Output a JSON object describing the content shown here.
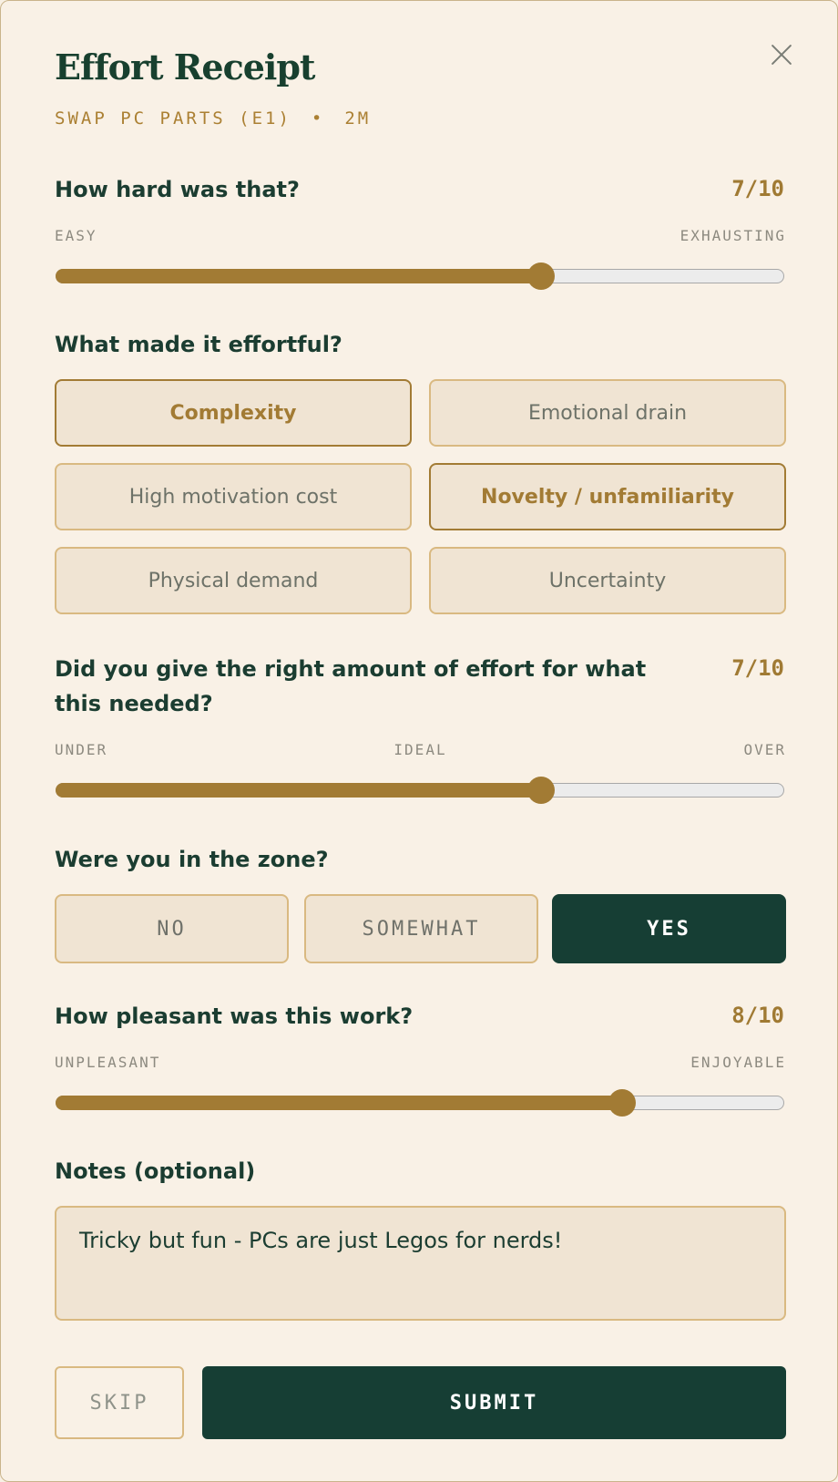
{
  "header": {
    "title": "Effort Receipt",
    "task": "SWAP PC PARTS (E1)",
    "separator": "•",
    "duration": "2M"
  },
  "difficulty": {
    "question": "How hard was that?",
    "score": "7/10",
    "value": 7,
    "max": 10,
    "min_label": "EASY",
    "max_label": "EXHAUSTING"
  },
  "effortful": {
    "question": "What made it effortful?",
    "options": [
      {
        "label": "Complexity",
        "selected": true
      },
      {
        "label": "Emotional drain",
        "selected": false
      },
      {
        "label": "High motivation cost",
        "selected": false
      },
      {
        "label": "Novelty / unfamiliarity",
        "selected": true
      },
      {
        "label": "Physical demand",
        "selected": false
      },
      {
        "label": "Uncertainty",
        "selected": false
      }
    ]
  },
  "effort_amount": {
    "question": "Did you give the right amount of effort for what this needed?",
    "score": "7/10",
    "value": 7,
    "max": 10,
    "min_label": "UNDER",
    "mid_label": "IDEAL",
    "max_label": "OVER"
  },
  "zone": {
    "question": "Were you in the zone?",
    "options": [
      {
        "label": "NO",
        "selected": false
      },
      {
        "label": "SOMEWHAT",
        "selected": false
      },
      {
        "label": "YES",
        "selected": true
      }
    ]
  },
  "pleasantness": {
    "question": "How pleasant was this work?",
    "score": "8/10",
    "value": 8,
    "max": 10,
    "min_label": "UNPLEASANT",
    "max_label": "ENJOYABLE"
  },
  "notes": {
    "label": "Notes (optional)",
    "value": "Tricky but fun - PCs are just Legos for nerds!"
  },
  "actions": {
    "skip_label": "SKIP",
    "submit_label": "SUBMIT"
  },
  "colors": {
    "accent": "#a27b34",
    "primary": "#163e34",
    "background": "#f9f1e6"
  }
}
